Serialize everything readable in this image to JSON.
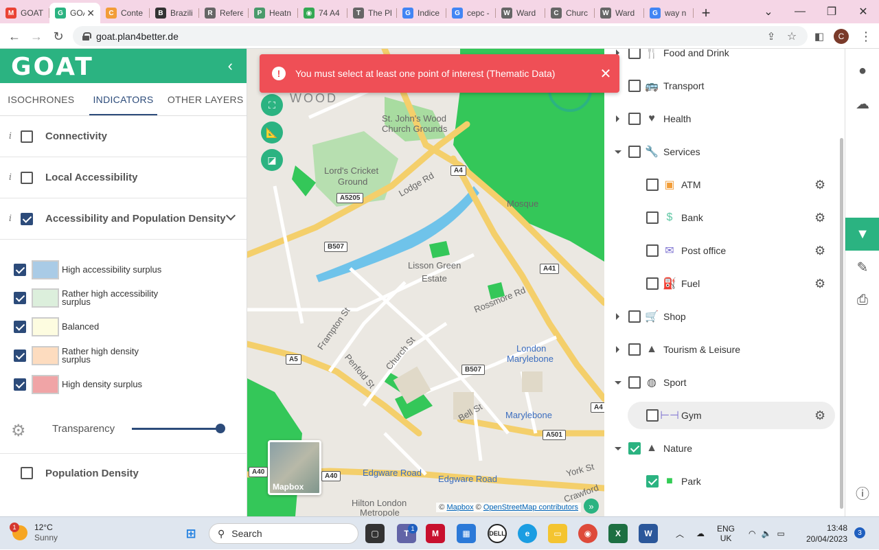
{
  "browser": {
    "tabs": [
      {
        "title": "GOAT",
        "favicon": "gmail-icon",
        "color": "#ea4335",
        "glyph": "M"
      },
      {
        "title": "GOAT",
        "favicon": "goat-icon",
        "color": "#2bb381",
        "glyph": "G",
        "active": true
      },
      {
        "title": "Conte",
        "favicon": "content-icon",
        "color": "#f29d38",
        "glyph": "C"
      },
      {
        "title": "Brazili",
        "favicon": "building-icon",
        "color": "#333333",
        "glyph": "B"
      },
      {
        "title": "Refere",
        "favicon": "globe-icon",
        "color": "#666666",
        "glyph": "R"
      },
      {
        "title": "Heatn",
        "favicon": "pb-icon",
        "color": "#4a9a6b",
        "glyph": "P"
      },
      {
        "title": "74 A4",
        "favicon": "maps-icon",
        "color": "#34a853",
        "glyph": "◉"
      },
      {
        "title": "The Pl",
        "favicon": "globe-icon",
        "color": "#666666",
        "glyph": "T"
      },
      {
        "title": "Indice",
        "favicon": "google-icon",
        "color": "#4285f4",
        "glyph": "G"
      },
      {
        "title": "cepc -",
        "favicon": "google-icon",
        "color": "#4285f4",
        "glyph": "G"
      },
      {
        "title": "Ward",
        "favicon": "globe-icon",
        "color": "#666666",
        "glyph": "W"
      },
      {
        "title": "Churc",
        "favicon": "globe-icon",
        "color": "#666666",
        "glyph": "C"
      },
      {
        "title": "Ward",
        "favicon": "globe-icon",
        "color": "#666666",
        "glyph": "W"
      },
      {
        "title": "way n",
        "favicon": "google-icon",
        "color": "#4285f4",
        "glyph": "G"
      }
    ],
    "url": "goat.plan4better.de",
    "profile_initial": "C"
  },
  "left_panel": {
    "logo": "GOAT",
    "tabs": [
      "ISOCHRONES",
      "INDICATORS",
      "OTHER LAYERS"
    ],
    "active_tab": 1,
    "layers": [
      {
        "label": "Connectivity",
        "checked": false
      },
      {
        "label": "Local Accessibility",
        "checked": false
      },
      {
        "label": "Accessibility and Population Density",
        "checked": true
      }
    ],
    "legend": [
      {
        "label": "High accessibility surplus",
        "color": "#a9cbe6"
      },
      {
        "label": "Rather high accessibility surplus",
        "color": "#dcefdc"
      },
      {
        "label": "Balanced",
        "color": "#fdfce0"
      },
      {
        "label": "Rather high density surplus",
        "color": "#fddcbf"
      },
      {
        "label": "High density surplus",
        "color": "#f0a4a6"
      }
    ],
    "transparency_label": "Transparency",
    "transparency_value": 1.0,
    "population_density": {
      "label": "Population Density",
      "checked": false
    }
  },
  "toast": {
    "message": "You must select at least one point of interest (Thematic Data)",
    "color": "#ef4f56"
  },
  "map": {
    "labels": {
      "wood": "WOOD",
      "st_johns": "St. John's Wood",
      "church_grounds": "Church Grounds",
      "lords1": "Lord's Cricket",
      "lords2": "Ground",
      "lodge_rd": "Lodge Rd",
      "mosque": "Mosque",
      "lisson1": "Lisson Green",
      "lisson2": "Estate",
      "rossmore": "Rossmore Rd",
      "frampton": "Frampton St",
      "penfold": "Penfold St",
      "church_st": "Church St",
      "london_mary1": "London",
      "london_mary2": "Marylebone",
      "bell_st": "Bell St",
      "marylebone": "Marylebone",
      "edgware1": "Edgware Road",
      "edgware2": "Edgware Road",
      "york_st": "York St",
      "crawford": "Crawford",
      "hilton1": "Hilton London",
      "hilton2": "Metropole"
    },
    "shields": {
      "a5205": "A5205",
      "b507a": "B507",
      "a41": "A41",
      "a4": "A4",
      "a5": "A5",
      "b507b": "B507",
      "a501": "A501",
      "a40a": "A40",
      "a40b": "A40",
      "a4x": "A4"
    },
    "minimap_label": "Mapbox",
    "attribution_prefix": "©",
    "attribution_mapbox": "Mapbox",
    "attribution_mid": "©",
    "attribution_osm": "OpenStreetMap contributors"
  },
  "poi": {
    "items": [
      {
        "label": "Food and Drink",
        "level": 0,
        "expand": "right",
        "checked": false,
        "icon": "fork-knife-icon",
        "glyph": "🍴"
      },
      {
        "label": "Transport",
        "level": 0,
        "expand": "right",
        "checked": false,
        "icon": "bus-icon",
        "glyph": "🚌"
      },
      {
        "label": "Health",
        "level": 0,
        "expand": "right",
        "checked": false,
        "icon": "heart-icon",
        "glyph": "♥"
      },
      {
        "label": "Services",
        "level": 0,
        "expand": "down",
        "checked": false,
        "icon": "wrench-icon",
        "glyph": "🔧"
      },
      {
        "label": "ATM",
        "level": 1,
        "checked": false,
        "icon": "atm-icon",
        "glyph": "▣",
        "color": "#f29d38",
        "gear": true
      },
      {
        "label": "Bank",
        "level": 1,
        "checked": false,
        "icon": "money-bag-icon",
        "glyph": "$",
        "color": "#5fc7a4",
        "gear": true
      },
      {
        "label": "Post office",
        "level": 1,
        "checked": false,
        "icon": "envelope-icon",
        "glyph": "✉",
        "color": "#7b6fd0",
        "gear": true
      },
      {
        "label": "Fuel",
        "level": 1,
        "checked": false,
        "icon": "fuel-pump-icon",
        "glyph": "⛽",
        "color": "#1f4b8e",
        "gear": true
      },
      {
        "label": "Shop",
        "level": 0,
        "expand": "right",
        "checked": false,
        "icon": "cart-icon",
        "glyph": "🛒"
      },
      {
        "label": "Tourism & Leisure",
        "level": 0,
        "expand": "right",
        "checked": false,
        "icon": "tree-icon",
        "glyph": "▲"
      },
      {
        "label": "Sport",
        "level": 0,
        "expand": "down",
        "checked": false,
        "icon": "basketball-icon",
        "glyph": "◍"
      },
      {
        "label": "Gym",
        "level": 1,
        "checked": false,
        "icon": "dumbbell-icon",
        "glyph": "⊢⊣",
        "color": "#7b6fd0",
        "gear": true
      },
      {
        "label": "Nature",
        "level": 0,
        "expand": "down",
        "checked": true,
        "icon": "tree-icon",
        "glyph": "▲"
      },
      {
        "label": "Park",
        "level": 1,
        "checked": true,
        "icon": "park-icon",
        "glyph": "■",
        "color": "#33cc55"
      }
    ]
  },
  "taskbar": {
    "weather_temp": "12°C",
    "weather_desc": "Sunny",
    "weather_badge": "1",
    "search_label": "Search",
    "lang1": "ENG",
    "lang2": "UK",
    "time": "13:48",
    "date": "20/04/2023",
    "notifications": "3",
    "teams_badge": "1"
  }
}
